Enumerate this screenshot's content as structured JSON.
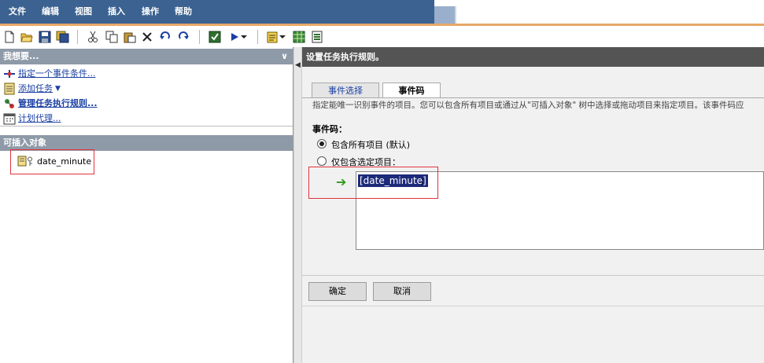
{
  "menu": {
    "items": [
      "文件",
      "编辑",
      "视图",
      "插入",
      "操作",
      "帮助"
    ]
  },
  "toolbar": {
    "icons": [
      "new-file-icon",
      "open-folder-icon",
      "save-icon",
      "save-all-icon",
      "cut-icon",
      "copy-icon",
      "paste-icon",
      "delete-icon",
      "undo-icon",
      "redo-icon",
      "check-icon",
      "run-icon",
      "dropdown-icon",
      "properties-icon",
      "dropdown-icon",
      "grid-icon",
      "report-icon"
    ]
  },
  "left": {
    "tasks_header": "我想要...",
    "tasks": [
      {
        "label": "指定一个事件条件...",
        "icon": "event-condition-icon"
      },
      {
        "label": "添加任务",
        "icon": "add-task-icon"
      },
      {
        "label": "管理任务执行规则...",
        "icon": "manage-rules-icon"
      },
      {
        "label": "计划代理...",
        "icon": "schedule-icon"
      }
    ],
    "insertable_header": "可插入对象",
    "objects": [
      {
        "label": "date_minute",
        "icon": "data-item-icon"
      }
    ]
  },
  "right": {
    "header": "设置任务执行规则。",
    "tabs": [
      "事件选择",
      "事件码"
    ],
    "description": "指定能唯一识别事件的项目。您可以包含所有项目或通过从\"可插入对象\" 树中选择或拖动项目来指定项目。该事件码应",
    "eventcode_label": "事件码：",
    "options": [
      "包含所有项目 (默认)",
      "仅包含选定项目："
    ],
    "selected_option": 0,
    "code_value": "[date_minute]",
    "code_suffix": ";",
    "ok_label": "确定",
    "cancel_label": "取消"
  },
  "colors": {
    "menubar": "#3b6291",
    "accent_line": "#e7a868",
    "panel_header": "#8f9aa8",
    "right_header": "#545454",
    "highlight_box": "#e0343c",
    "selection": "#1d2a7a"
  }
}
